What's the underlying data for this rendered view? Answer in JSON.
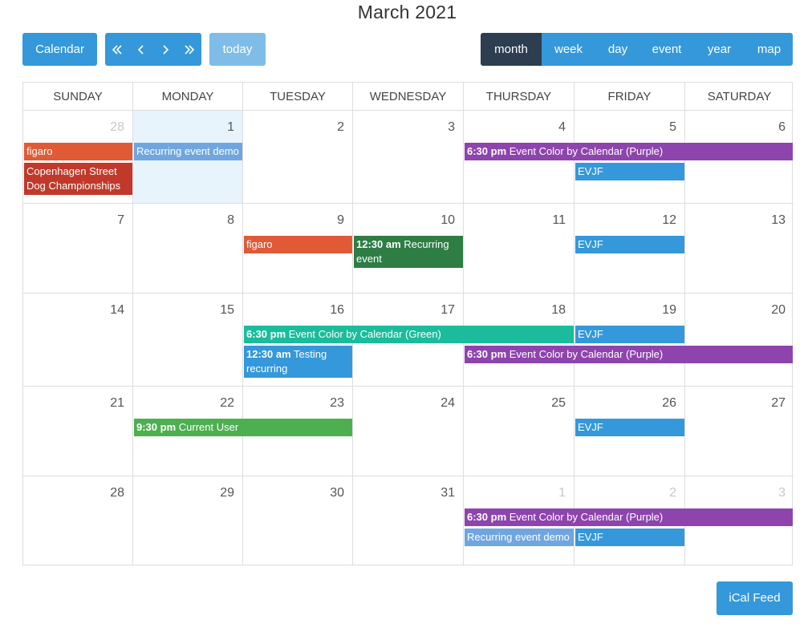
{
  "header": {
    "title": "March 2021"
  },
  "toolbar": {
    "calendar_label": "Calendar",
    "today_label": "today",
    "nav": [
      "«",
      "‹",
      "›",
      "»"
    ]
  },
  "views": [
    "month",
    "week",
    "day",
    "event",
    "year",
    "map"
  ],
  "active_view": "month",
  "weekdays": [
    "SUNDAY",
    "MONDAY",
    "TUESDAY",
    "WEDNESDAY",
    "THURSDAY",
    "FRIDAY",
    "SATURDAY"
  ],
  "weeks": [
    [
      {
        "d": "28",
        "o": true
      },
      {
        "d": "1",
        "today": true
      },
      {
        "d": "2"
      },
      {
        "d": "3"
      },
      {
        "d": "4"
      },
      {
        "d": "5"
      },
      {
        "d": "6"
      }
    ],
    [
      {
        "d": "7"
      },
      {
        "d": "8"
      },
      {
        "d": "9"
      },
      {
        "d": "10"
      },
      {
        "d": "11"
      },
      {
        "d": "12"
      },
      {
        "d": "13"
      }
    ],
    [
      {
        "d": "14"
      },
      {
        "d": "15"
      },
      {
        "d": "16"
      },
      {
        "d": "17"
      },
      {
        "d": "18"
      },
      {
        "d": "19"
      },
      {
        "d": "20"
      }
    ],
    [
      {
        "d": "21"
      },
      {
        "d": "22"
      },
      {
        "d": "23"
      },
      {
        "d": "24"
      },
      {
        "d": "25"
      },
      {
        "d": "26"
      },
      {
        "d": "27"
      }
    ],
    [
      {
        "d": "28"
      },
      {
        "d": "29"
      },
      {
        "d": "30"
      },
      {
        "d": "31"
      },
      {
        "d": "1",
        "o": true
      },
      {
        "d": "2",
        "o": true
      },
      {
        "d": "3",
        "o": true
      }
    ]
  ],
  "events": [
    {
      "week": 0,
      "day": 0,
      "span": 1,
      "slot": 0,
      "time": "",
      "title": "figaro",
      "color": "#e05a36"
    },
    {
      "week": 0,
      "day": 0,
      "span": 1,
      "slot": 1,
      "lines": 2,
      "time": "",
      "title": "Copenhagen Street Dog Championships",
      "color": "#c0392b"
    },
    {
      "week": 0,
      "day": 1,
      "span": 1,
      "slot": 0,
      "time": "",
      "title": "Recurring event demo",
      "color": "#6fa6e0"
    },
    {
      "week": 0,
      "day": 4,
      "span": 3,
      "slot": 0,
      "time": "6:30 pm",
      "title": "Event Color by Calendar (Purple)",
      "color": "#8e44ad"
    },
    {
      "week": 0,
      "day": 5,
      "span": 1,
      "slot": 1,
      "time": "",
      "title": "EVJF",
      "color": "#3498db"
    },
    {
      "week": 1,
      "day": 2,
      "span": 1,
      "slot": 0,
      "time": "",
      "title": "figaro",
      "color": "#e05a36"
    },
    {
      "week": 1,
      "day": 3,
      "span": 1,
      "slot": 0,
      "lines": 2,
      "time": "12:30 am",
      "title": "Recurring event",
      "color": "#2e7d45"
    },
    {
      "week": 1,
      "day": 5,
      "span": 1,
      "slot": 0,
      "time": "",
      "title": "EVJF",
      "color": "#3498db"
    },
    {
      "week": 2,
      "day": 2,
      "span": 3,
      "slot": 0,
      "time": "6:30 pm",
      "title": "Event Color by Calendar (Green)",
      "color": "#1abc9c"
    },
    {
      "week": 2,
      "day": 5,
      "span": 1,
      "slot": 0,
      "time": "",
      "title": "EVJF",
      "color": "#3498db"
    },
    {
      "week": 2,
      "day": 2,
      "span": 1,
      "slot": 1,
      "lines": 2,
      "time": "12:30 am",
      "title": "Testing recurring",
      "color": "#3498db"
    },
    {
      "week": 2,
      "day": 4,
      "span": 3,
      "slot": 1,
      "time": "6:30 pm",
      "title": "Event Color by Calendar (Purple)",
      "color": "#8e44ad"
    },
    {
      "week": 3,
      "day": 1,
      "span": 2,
      "slot": 0,
      "time": "9:30 pm",
      "title": "Current User",
      "color": "#4caf50"
    },
    {
      "week": 3,
      "day": 5,
      "span": 1,
      "slot": 0,
      "time": "",
      "title": "EVJF",
      "color": "#3498db"
    },
    {
      "week": 4,
      "day": 4,
      "span": 3,
      "slot": 0,
      "time": "6:30 pm",
      "title": "Event Color by Calendar (Purple)",
      "color": "#8e44ad"
    },
    {
      "week": 4,
      "day": 4,
      "span": 1,
      "slot": 1,
      "time": "",
      "title": "Recurring event demo",
      "color": "#6fa6e0"
    },
    {
      "week": 4,
      "day": 5,
      "span": 1,
      "slot": 1,
      "time": "",
      "title": "EVJF",
      "color": "#3498db"
    }
  ],
  "footer": {
    "ical_label": "iCal Feed"
  }
}
